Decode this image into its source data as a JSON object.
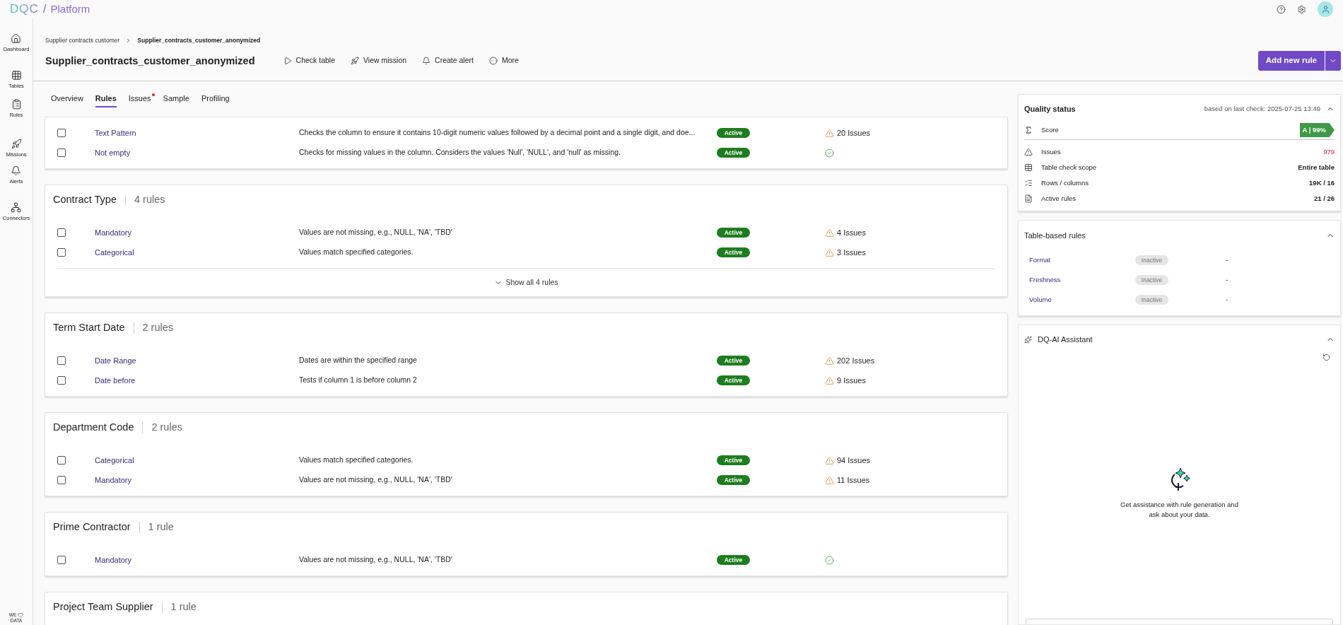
{
  "top_bar": {
    "logo": "DQC",
    "separator": "/",
    "product": "Platform"
  },
  "sidebar": {
    "items": [
      {
        "label": "Dashboard"
      },
      {
        "label": "Tables"
      },
      {
        "label": "Rules"
      },
      {
        "label": "Missions"
      },
      {
        "label": "Alerts"
      },
      {
        "label": "Connectors"
      }
    ],
    "footer_top": "WE",
    "footer_bottom": "DATA"
  },
  "breadcrumb": [
    "Supplier contracts customer",
    "Supplier_contracts_customer_anonymized"
  ],
  "page_title": "Supplier_contracts_customer_anonymized",
  "actions": [
    {
      "label": "Check table"
    },
    {
      "label": "View mission"
    },
    {
      "label": "Create alert"
    },
    {
      "label": "More"
    }
  ],
  "primary_button": "Add new rule",
  "tabs": [
    {
      "label": "Overview",
      "selected": false,
      "dot": false
    },
    {
      "label": "Rules",
      "selected": true,
      "dot": false
    },
    {
      "label": "Issues",
      "selected": false,
      "dot": true
    },
    {
      "label": "Sample",
      "selected": false,
      "dot": false
    },
    {
      "label": "Profiling",
      "selected": false,
      "dot": false
    }
  ],
  "rule_groups": [
    {
      "rules": [
        {
          "checked": false,
          "name": "Text Pattern",
          "description": "Checks the column to ensure it contains 10-digit numeric values followed by a decimal point and a single digit, and doe...",
          "badge": {
            "label": "Active",
            "active": true
          },
          "kind": "issues",
          "issues": "20 Issues"
        },
        {
          "checked": false,
          "name": "Not empty",
          "description": "Checks for missing values in the column. Considers the values 'Null', 'NULL', and 'null' as missing.",
          "badge": {
            "label": "Active",
            "active": true
          },
          "kind": "passed"
        }
      ]
    },
    {
      "title": "Contract Type",
      "count": "4 rules",
      "rules": [
        {
          "checked": false,
          "name": "Mandatory",
          "description": "Values are not missing, e.g., NULL, 'NA', 'TBD'",
          "badge": {
            "label": "Active",
            "active": true
          },
          "kind": "issues",
          "issues": "4 Issues"
        },
        {
          "checked": false,
          "name": "Categorical",
          "description": "Values match specified categories.",
          "badge": {
            "label": "Active",
            "active": true
          },
          "kind": "issues",
          "issues": "3 Issues"
        }
      ],
      "show_all": "Show all 4 rules"
    },
    {
      "title": "Term Start Date",
      "count": "2 rules",
      "rules": [
        {
          "checked": false,
          "name": "Date Range",
          "description": "Dates are within the specified range",
          "badge": {
            "label": "Active",
            "active": true
          },
          "kind": "issues",
          "issues": "202 Issues"
        },
        {
          "checked": false,
          "name": "Date before",
          "description": "Tests if column 1 is before column 2",
          "badge": {
            "label": "Active",
            "active": true
          },
          "kind": "issues",
          "issues": "9 Issues"
        }
      ]
    },
    {
      "title": "Department Code",
      "count": "2 rules",
      "rules": [
        {
          "checked": false,
          "name": "Categorical",
          "description": "Values match specified categories.",
          "badge": {
            "label": "Active",
            "active": true
          },
          "kind": "issues",
          "issues": "94 Issues"
        },
        {
          "checked": false,
          "name": "Mandatory",
          "description": "Values are not missing, e.g., NULL, 'NA', 'TBD'",
          "badge": {
            "label": "Active",
            "active": true
          },
          "kind": "issues",
          "issues": "11 Issues"
        }
      ]
    },
    {
      "title": "Prime Contractor",
      "count": "1 rule",
      "rules": [
        {
          "checked": false,
          "name": "Mandatory",
          "description": "Values are not missing, e.g., NULL, 'NA', 'TBD'",
          "badge": {
            "label": "Active",
            "active": true
          },
          "kind": "passed"
        }
      ]
    },
    {
      "title": "Project Team Supplier",
      "count": "1 rule"
    }
  ],
  "quality_status": {
    "title": "Quality status",
    "last_check": "based on last check: 2025-07-25 13:49",
    "score_label": "Score",
    "score": "A | 99%",
    "metrics": [
      {
        "label": "Issues",
        "value": "979",
        "alert": true
      },
      {
        "label": "Table check scope",
        "value": "Entire table",
        "alert": false
      },
      {
        "label": "Rows / columns",
        "value": "19K / 16",
        "alert": false
      },
      {
        "label": "Active rules",
        "value": "21 / 26",
        "alert": false
      }
    ]
  },
  "table_rules": {
    "title": "Table-based rules",
    "rules": [
      {
        "name": "Format",
        "badge": {
          "label": "Inactive",
          "active": false
        },
        "value": "-"
      },
      {
        "name": "Freshness",
        "badge": {
          "label": "Inactive",
          "active": false
        },
        "value": "-"
      },
      {
        "name": "Volume",
        "badge": {
          "label": "Inactive",
          "active": false
        },
        "value": "-"
      }
    ]
  },
  "assistant": {
    "title": "DQ-AI Assistant",
    "message": "Get assistance with rule generation and ask about your data."
  }
}
